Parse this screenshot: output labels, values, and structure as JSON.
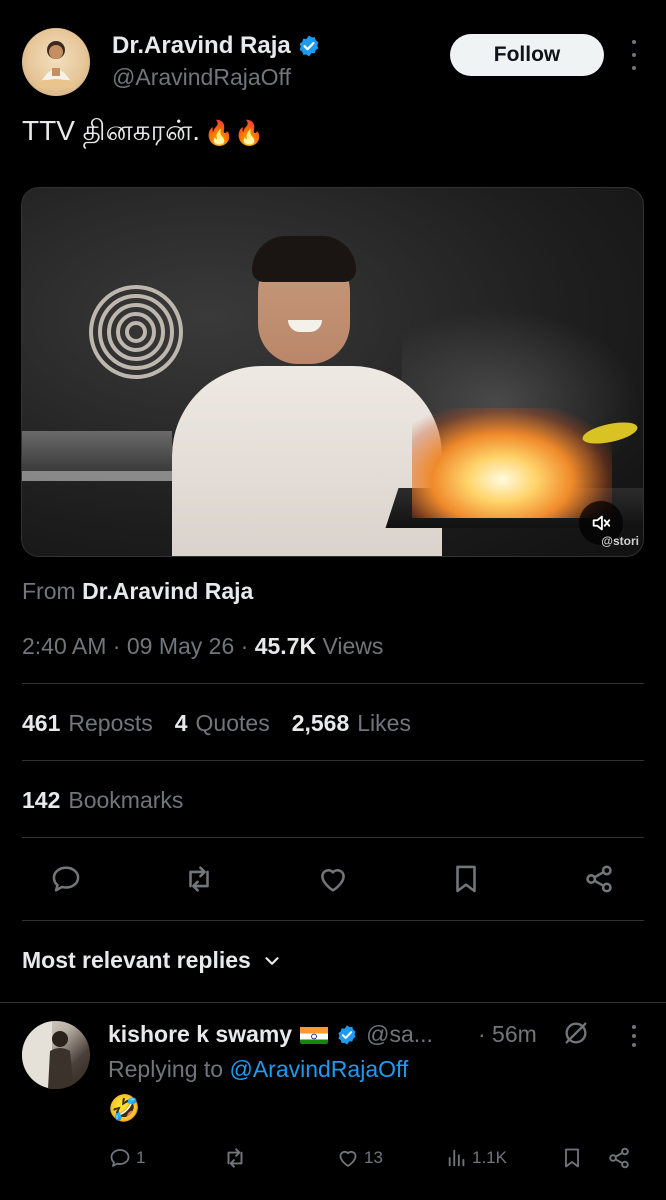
{
  "author": {
    "name": "Dr.Aravind Raja",
    "handle": "@AravindRajaOff",
    "verified": true,
    "avatar_icon": "sage-avatar-icon"
  },
  "follow_label": "Follow",
  "tweet": {
    "text": "TTV தினகரன்.",
    "emoji": "🔥🔥"
  },
  "media": {
    "watermark": "@stori",
    "sound_icon": "volume-icon"
  },
  "from": {
    "prefix": "From",
    "name": "Dr.Aravind Raja"
  },
  "meta": {
    "time": "2:40 AM",
    "date": "09 May 26",
    "views_count": "45.7K",
    "views_label": "Views",
    "separator": "·"
  },
  "stats": {
    "reposts_count": "461",
    "reposts_label": "Reposts",
    "quotes_count": "4",
    "quotes_label": "Quotes",
    "likes_count": "2,568",
    "likes_label": "Likes",
    "bookmarks_count": "142",
    "bookmarks_label": "Bookmarks"
  },
  "actions": [
    "reply-icon",
    "repost-icon",
    "like-icon",
    "bookmark-icon",
    "share-icon"
  ],
  "sort_label": "Most relevant replies",
  "reply": {
    "name": "kishore k swamy",
    "handle": "@sa...",
    "time": "· 56m",
    "replying_prefix": "Replying to",
    "replying_to": "@AravindRajaOff",
    "text": "🤣",
    "reply_count": "1",
    "like_count": "13",
    "view_count": "1.1K"
  },
  "colors": {
    "background": "#000000",
    "text_primary": "#e7e9ea",
    "text_secondary": "#71767b",
    "accent": "#1d9bf0",
    "divider": "#2f3336"
  }
}
